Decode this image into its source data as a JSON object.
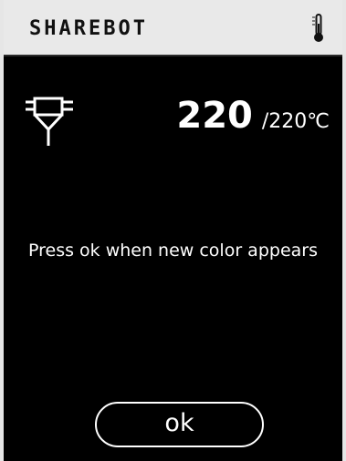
{
  "header": {
    "title": "SHAREBOT",
    "icon": "thermometer-icon"
  },
  "extruder": {
    "icon": "nozzle-icon",
    "current_temp": "220",
    "target_temp": "/220℃"
  },
  "message": "Press ok when new color appears",
  "ok_button": {
    "label": "ok"
  },
  "colors": {
    "screen_bg": "#000000",
    "header_bg": "#e9e9e9",
    "text": "#ffffff"
  }
}
